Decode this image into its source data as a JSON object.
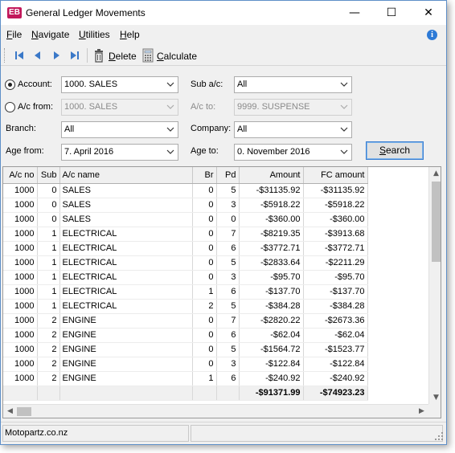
{
  "window": {
    "logo": "EB",
    "title": "General Ledger Movements",
    "controls": {
      "minimize": "—",
      "maximize": "☐",
      "close": "✕"
    }
  },
  "menu": {
    "file": {
      "accel": "F",
      "rest": "ile"
    },
    "navigate": {
      "accel": "N",
      "rest": "avigate"
    },
    "utilities": {
      "accel": "U",
      "rest": "tilities"
    },
    "help": {
      "accel": "H",
      "rest": "elp"
    },
    "info_icon": "i"
  },
  "toolbar": {
    "delete_accel": "D",
    "delete_rest": "elete",
    "calculate_accel": "C",
    "calculate_rest": "alculate"
  },
  "filters": {
    "account_label": "Account:",
    "account_value": "1000. SALES",
    "acfrom_label": "A/c from:",
    "acfrom_value": "1000. SALES",
    "branch_label": "Branch:",
    "branch_value": "All",
    "agefrom_label": "Age from:",
    "agefrom_value": "7. April 2016",
    "subac_label": "Sub a/c:",
    "subac_value": "All",
    "acto_label": "A/c to:",
    "acto_value": "9999. SUSPENSE",
    "company_label": "Company:",
    "company_value": "All",
    "ageto_label": "Age to:",
    "ageto_value": "0. November 2016",
    "search_accel": "S",
    "search_rest": "earch",
    "selected_radio": "account"
  },
  "grid": {
    "columns": [
      "A/c no",
      "Sub",
      "A/c name",
      "Br",
      "Pd",
      "Amount",
      "FC amount"
    ],
    "rows": [
      [
        "1000",
        "0",
        "SALES",
        "0",
        "5",
        "-$31135.92",
        "-$31135.92"
      ],
      [
        "1000",
        "0",
        "SALES",
        "0",
        "3",
        "-$5918.22",
        "-$5918.22"
      ],
      [
        "1000",
        "0",
        "SALES",
        "0",
        "0",
        "-$360.00",
        "-$360.00"
      ],
      [
        "1000",
        "1",
        "ELECTRICAL",
        "0",
        "7",
        "-$8219.35",
        "-$3913.68"
      ],
      [
        "1000",
        "1",
        "ELECTRICAL",
        "0",
        "6",
        "-$3772.71",
        "-$3772.71"
      ],
      [
        "1000",
        "1",
        "ELECTRICAL",
        "0",
        "5",
        "-$2833.64",
        "-$2211.29"
      ],
      [
        "1000",
        "1",
        "ELECTRICAL",
        "0",
        "3",
        "-$95.70",
        "-$95.70"
      ],
      [
        "1000",
        "1",
        "ELECTRICAL",
        "1",
        "6",
        "-$137.70",
        "-$137.70"
      ],
      [
        "1000",
        "1",
        "ELECTRICAL",
        "2",
        "5",
        "-$384.28",
        "-$384.28"
      ],
      [
        "1000",
        "2",
        "ENGINE",
        "0",
        "7",
        "-$2820.22",
        "-$2673.36"
      ],
      [
        "1000",
        "2",
        "ENGINE",
        "0",
        "6",
        "-$62.04",
        "-$62.04"
      ],
      [
        "1000",
        "2",
        "ENGINE",
        "0",
        "5",
        "-$1564.72",
        "-$1523.77"
      ],
      [
        "1000",
        "2",
        "ENGINE",
        "0",
        "3",
        "-$122.84",
        "-$122.84"
      ],
      [
        "1000",
        "2",
        "ENGINE",
        "1",
        "6",
        "-$240.92",
        "-$240.92"
      ]
    ],
    "total_amount": "-$91371.99",
    "total_fc_amount": "-$74923.23"
  },
  "status": {
    "company": "Motopartz.co.nz"
  },
  "colors": {
    "accent": "#3c7fd1",
    "logo": "#c2185b",
    "info": "#2d7ad6",
    "nav_icon": "#3a78c8"
  }
}
